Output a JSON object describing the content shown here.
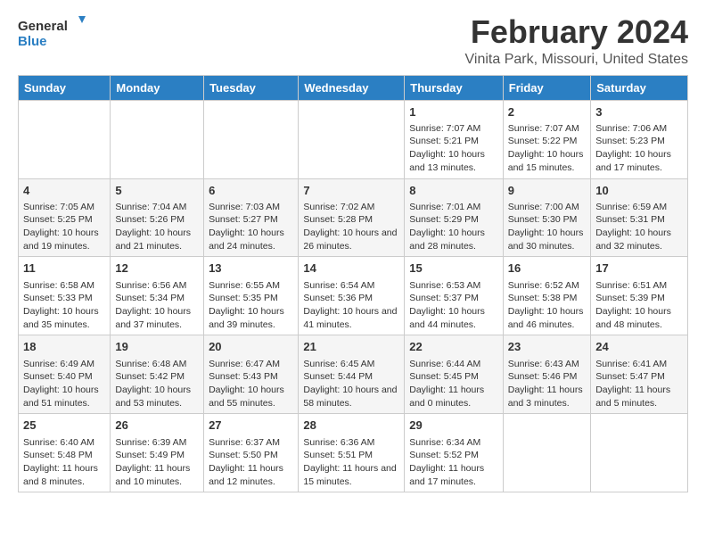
{
  "logo": {
    "line1": "General",
    "line2": "Blue"
  },
  "title": "February 2024",
  "subtitle": "Vinita Park, Missouri, United States",
  "days_of_week": [
    "Sunday",
    "Monday",
    "Tuesday",
    "Wednesday",
    "Thursday",
    "Friday",
    "Saturday"
  ],
  "weeks": [
    [
      {
        "day": "",
        "empty": true
      },
      {
        "day": "",
        "empty": true
      },
      {
        "day": "",
        "empty": true
      },
      {
        "day": "",
        "empty": true
      },
      {
        "day": "1",
        "sunrise": "Sunrise: 7:07 AM",
        "sunset": "Sunset: 5:21 PM",
        "daylight": "Daylight: 10 hours and 13 minutes."
      },
      {
        "day": "2",
        "sunrise": "Sunrise: 7:07 AM",
        "sunset": "Sunset: 5:22 PM",
        "daylight": "Daylight: 10 hours and 15 minutes."
      },
      {
        "day": "3",
        "sunrise": "Sunrise: 7:06 AM",
        "sunset": "Sunset: 5:23 PM",
        "daylight": "Daylight: 10 hours and 17 minutes."
      }
    ],
    [
      {
        "day": "4",
        "sunrise": "Sunrise: 7:05 AM",
        "sunset": "Sunset: 5:25 PM",
        "daylight": "Daylight: 10 hours and 19 minutes."
      },
      {
        "day": "5",
        "sunrise": "Sunrise: 7:04 AM",
        "sunset": "Sunset: 5:26 PM",
        "daylight": "Daylight: 10 hours and 21 minutes."
      },
      {
        "day": "6",
        "sunrise": "Sunrise: 7:03 AM",
        "sunset": "Sunset: 5:27 PM",
        "daylight": "Daylight: 10 hours and 24 minutes."
      },
      {
        "day": "7",
        "sunrise": "Sunrise: 7:02 AM",
        "sunset": "Sunset: 5:28 PM",
        "daylight": "Daylight: 10 hours and 26 minutes."
      },
      {
        "day": "8",
        "sunrise": "Sunrise: 7:01 AM",
        "sunset": "Sunset: 5:29 PM",
        "daylight": "Daylight: 10 hours and 28 minutes."
      },
      {
        "day": "9",
        "sunrise": "Sunrise: 7:00 AM",
        "sunset": "Sunset: 5:30 PM",
        "daylight": "Daylight: 10 hours and 30 minutes."
      },
      {
        "day": "10",
        "sunrise": "Sunrise: 6:59 AM",
        "sunset": "Sunset: 5:31 PM",
        "daylight": "Daylight: 10 hours and 32 minutes."
      }
    ],
    [
      {
        "day": "11",
        "sunrise": "Sunrise: 6:58 AM",
        "sunset": "Sunset: 5:33 PM",
        "daylight": "Daylight: 10 hours and 35 minutes."
      },
      {
        "day": "12",
        "sunrise": "Sunrise: 6:56 AM",
        "sunset": "Sunset: 5:34 PM",
        "daylight": "Daylight: 10 hours and 37 minutes."
      },
      {
        "day": "13",
        "sunrise": "Sunrise: 6:55 AM",
        "sunset": "Sunset: 5:35 PM",
        "daylight": "Daylight: 10 hours and 39 minutes."
      },
      {
        "day": "14",
        "sunrise": "Sunrise: 6:54 AM",
        "sunset": "Sunset: 5:36 PM",
        "daylight": "Daylight: 10 hours and 41 minutes."
      },
      {
        "day": "15",
        "sunrise": "Sunrise: 6:53 AM",
        "sunset": "Sunset: 5:37 PM",
        "daylight": "Daylight: 10 hours and 44 minutes."
      },
      {
        "day": "16",
        "sunrise": "Sunrise: 6:52 AM",
        "sunset": "Sunset: 5:38 PM",
        "daylight": "Daylight: 10 hours and 46 minutes."
      },
      {
        "day": "17",
        "sunrise": "Sunrise: 6:51 AM",
        "sunset": "Sunset: 5:39 PM",
        "daylight": "Daylight: 10 hours and 48 minutes."
      }
    ],
    [
      {
        "day": "18",
        "sunrise": "Sunrise: 6:49 AM",
        "sunset": "Sunset: 5:40 PM",
        "daylight": "Daylight: 10 hours and 51 minutes."
      },
      {
        "day": "19",
        "sunrise": "Sunrise: 6:48 AM",
        "sunset": "Sunset: 5:42 PM",
        "daylight": "Daylight: 10 hours and 53 minutes."
      },
      {
        "day": "20",
        "sunrise": "Sunrise: 6:47 AM",
        "sunset": "Sunset: 5:43 PM",
        "daylight": "Daylight: 10 hours and 55 minutes."
      },
      {
        "day": "21",
        "sunrise": "Sunrise: 6:45 AM",
        "sunset": "Sunset: 5:44 PM",
        "daylight": "Daylight: 10 hours and 58 minutes."
      },
      {
        "day": "22",
        "sunrise": "Sunrise: 6:44 AM",
        "sunset": "Sunset: 5:45 PM",
        "daylight": "Daylight: 11 hours and 0 minutes."
      },
      {
        "day": "23",
        "sunrise": "Sunrise: 6:43 AM",
        "sunset": "Sunset: 5:46 PM",
        "daylight": "Daylight: 11 hours and 3 minutes."
      },
      {
        "day": "24",
        "sunrise": "Sunrise: 6:41 AM",
        "sunset": "Sunset: 5:47 PM",
        "daylight": "Daylight: 11 hours and 5 minutes."
      }
    ],
    [
      {
        "day": "25",
        "sunrise": "Sunrise: 6:40 AM",
        "sunset": "Sunset: 5:48 PM",
        "daylight": "Daylight: 11 hours and 8 minutes."
      },
      {
        "day": "26",
        "sunrise": "Sunrise: 6:39 AM",
        "sunset": "Sunset: 5:49 PM",
        "daylight": "Daylight: 11 hours and 10 minutes."
      },
      {
        "day": "27",
        "sunrise": "Sunrise: 6:37 AM",
        "sunset": "Sunset: 5:50 PM",
        "daylight": "Daylight: 11 hours and 12 minutes."
      },
      {
        "day": "28",
        "sunrise": "Sunrise: 6:36 AM",
        "sunset": "Sunset: 5:51 PM",
        "daylight": "Daylight: 11 hours and 15 minutes."
      },
      {
        "day": "29",
        "sunrise": "Sunrise: 6:34 AM",
        "sunset": "Sunset: 5:52 PM",
        "daylight": "Daylight: 11 hours and 17 minutes."
      },
      {
        "day": "",
        "empty": true
      },
      {
        "day": "",
        "empty": true
      }
    ]
  ]
}
